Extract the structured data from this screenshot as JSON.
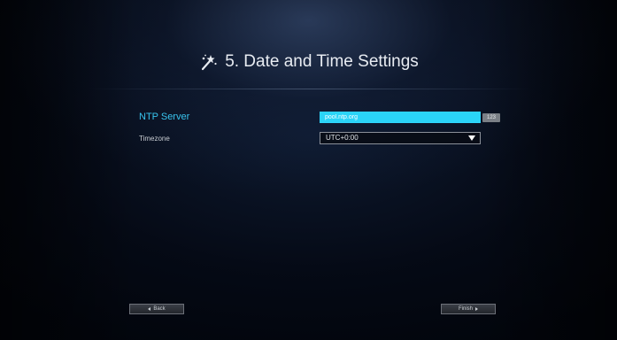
{
  "header": {
    "title": "5. Date and Time Settings",
    "icon": "magic-wand-icon"
  },
  "form": {
    "ntp": {
      "label": "NTP Server",
      "value": "pool.ntp.org",
      "input_mode": "123"
    },
    "timezone": {
      "label": "Timezone",
      "value": "UTC+0:00"
    }
  },
  "nav": {
    "back_label": "Back",
    "finish_label": "Finish"
  },
  "colors": {
    "accent": "#2ad4f8",
    "label_active": "#38c4ee"
  }
}
